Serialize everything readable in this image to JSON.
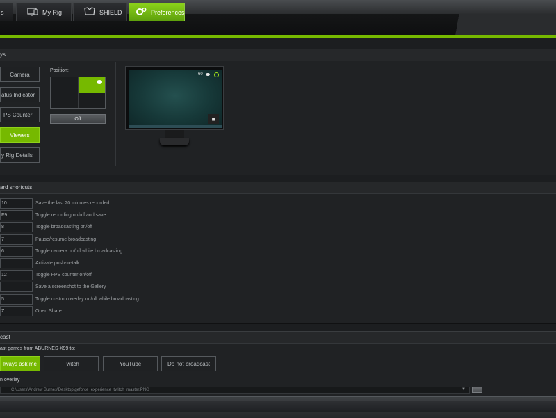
{
  "tabs": [
    {
      "label": "s",
      "icon": "games-icon"
    },
    {
      "label": "My Rig",
      "icon": "monitor-icon"
    },
    {
      "label": "SHIELD",
      "icon": "shield-icon"
    },
    {
      "label": "Preferences",
      "icon": "gear-icon",
      "active": true
    }
  ],
  "overlays": {
    "title": "ys",
    "buttons": [
      "Camera",
      "atus Indicator",
      "PS Counter",
      "Viewers",
      "y Rig Details"
    ],
    "active_button": "Viewers",
    "position_label": "Position:",
    "off_button": "Off",
    "preview": {
      "fps": "60"
    }
  },
  "shortcuts": {
    "title": "ard shortcuts",
    "rows": [
      {
        "key": "10",
        "desc": "Save the last 20 minutes recorded"
      },
      {
        "key": "F9",
        "desc": "Toggle recording on/off and save"
      },
      {
        "key": "8",
        "desc": "Toggle broadcasting on/off"
      },
      {
        "key": "7",
        "desc": "Pause/resume broadcasting"
      },
      {
        "key": "6",
        "desc": "Toggle camera on/off while broadcasting"
      },
      {
        "key": "",
        "desc": "Activate push-to-talk"
      },
      {
        "key": "12",
        "desc": "Toggle FPS counter on/off"
      },
      {
        "key": "",
        "desc": "Save a screenshot to the Gallery"
      },
      {
        "key": "5",
        "desc": "Toggle custom overlay on/off while broadcasting"
      },
      {
        "key": "Z",
        "desc": "Open Share"
      }
    ]
  },
  "broadcast": {
    "title": "cast",
    "label": "ast games from ABURNES-X99 to:",
    "options": [
      "lways ask me",
      "Twitch",
      "YouTube",
      "Do not broadcast"
    ],
    "active_option": "lways ask me",
    "overlay_label": "n overlay",
    "overlay_path": "C:\\Users\\Andrew Burnes\\Desktop\\geforce_experience_twitch_master.PNG"
  },
  "colors": {
    "accent": "#76b900",
    "background": "#1c1e20"
  }
}
